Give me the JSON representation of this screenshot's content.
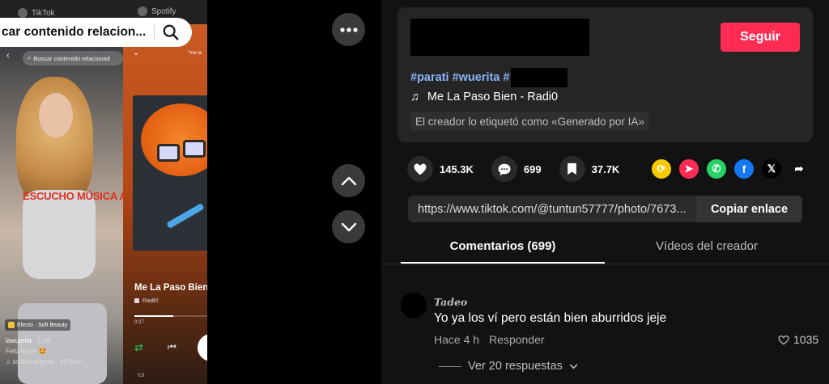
{
  "media": {
    "tiktok_label": "TikTok",
    "spotify_label": "Spotify",
    "search_text": "car contenido relacion...",
    "mini_search_text": "Buscar contenido relacionad",
    "overlay_text": "ESCUCHO MÚSICA AMOR",
    "effect_label": "Efecto · Soft Beauty",
    "username": "lawuerita",
    "date": "· 1-26",
    "caption": "Feliz lunes 🤩",
    "sound": "♫ sonido original - 917josh_...",
    "spotify_me_label": "\"me la",
    "song_title": "Me La Paso Bien",
    "song_artist": "Radi0",
    "time_elapsed": "0:27",
    "progress": 0.4
  },
  "controls": {
    "more": "more-options",
    "up": "previous-video",
    "down": "next-video"
  },
  "post": {
    "follow_label": "Seguir",
    "hashtags": [
      "#parati",
      "#wuerita",
      "#"
    ],
    "music": "Me La Paso Bien - Radi0",
    "ai_label": "El creador lo etiquetó como «Generado por IA»"
  },
  "stats": {
    "likes": "145.3K",
    "comments": "699",
    "saves": "37.7K"
  },
  "share": {
    "icons": [
      "repost-icon",
      "send-icon",
      "whatsapp-icon",
      "facebook-icon",
      "x-icon",
      "share-arrow-icon"
    ],
    "colors": {
      "repost": "#f7c900",
      "send": "#fe2c55",
      "whatsapp": "#25d366",
      "facebook": "#1877f2",
      "x": "#000000"
    }
  },
  "link": {
    "url": "https://www.tiktok.com/@tuntun57777/photo/7673...",
    "copy_label": "Copiar enlace"
  },
  "tabs": {
    "comments": "Comentarios (699)",
    "creator_videos": "Vídeos del creador"
  },
  "comment": {
    "author": "Tadeo",
    "text": "Yo ya los ví pero están bien aburridos jeje",
    "time": "Hace 4 h",
    "reply_label": "Responder",
    "likes": "1035",
    "view_replies": "Ver 20 respuestas"
  },
  "colors": {
    "accent": "#fe2c55",
    "hashtag": "#8ab4f8",
    "panel_bg": "#121212",
    "card_bg": "#252525"
  }
}
